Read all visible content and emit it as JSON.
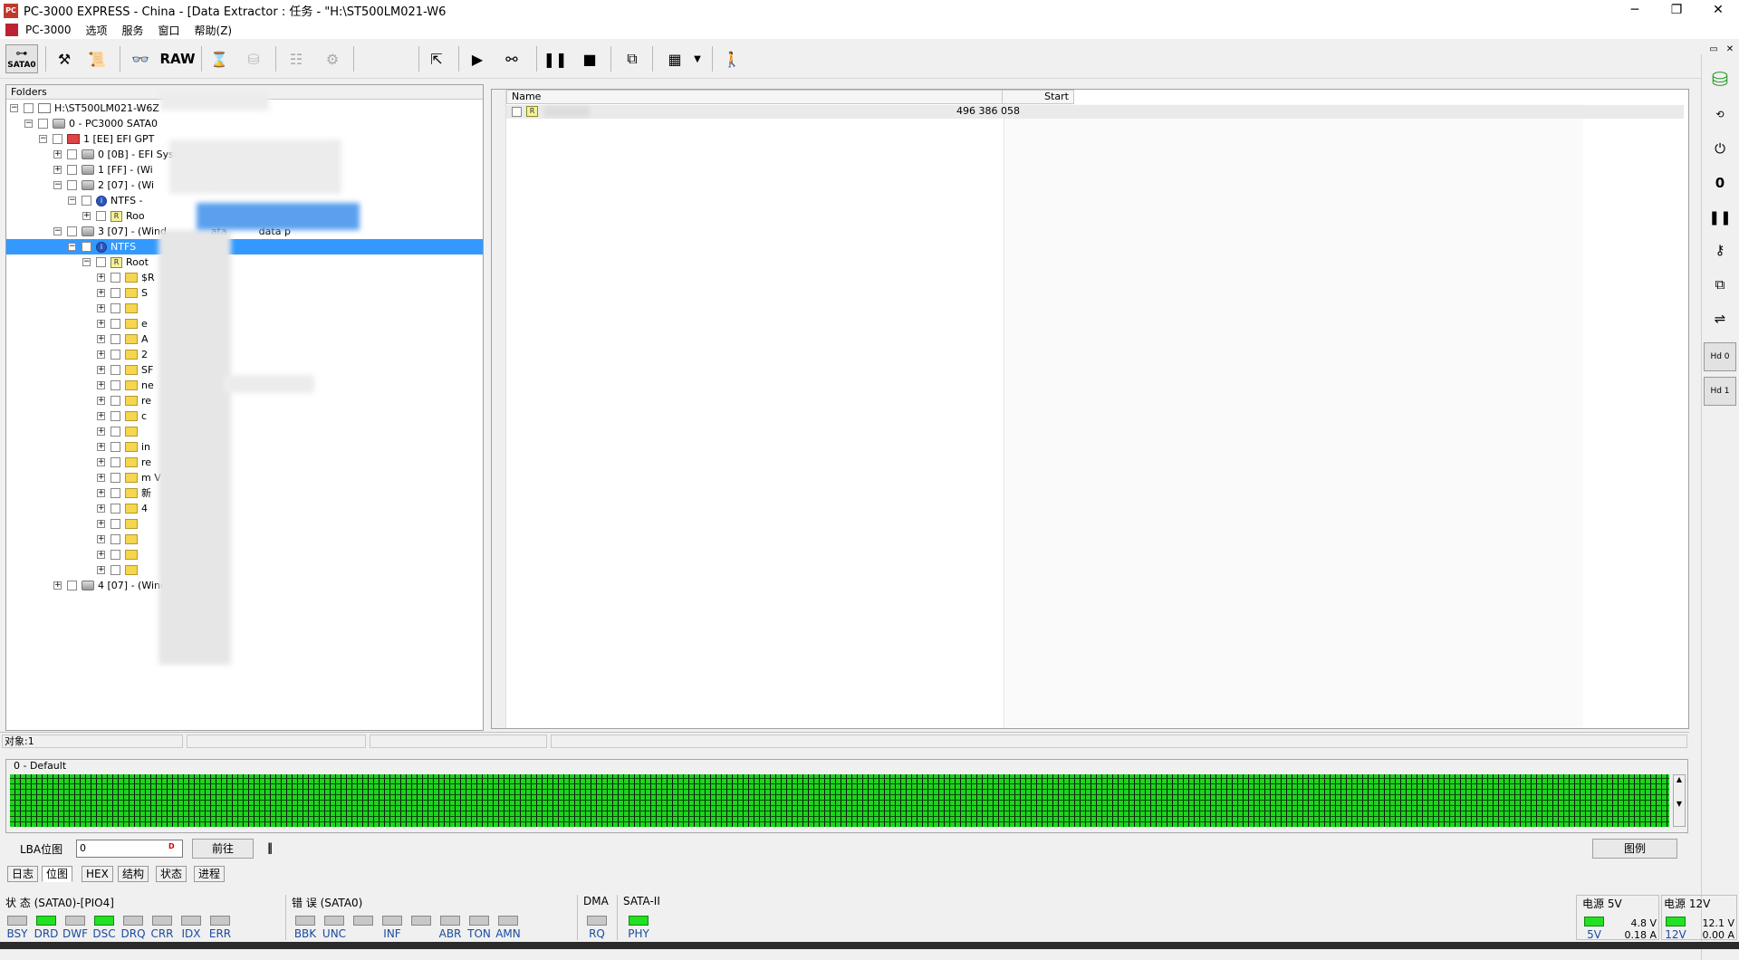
{
  "window": {
    "title": "PC-3000 EXPRESS - China - [Data Extractor : 任务 - \"H:\\ST500LM021-W6",
    "controls": {
      "minimize": "─",
      "restore": "❐",
      "close": "✕"
    }
  },
  "menu": {
    "items": [
      "PC-3000",
      "选项",
      "服务",
      "窗口",
      "帮助(Z)"
    ],
    "mdi_controls": {
      "minimize": "_",
      "restore": "▭",
      "close": "✕"
    }
  },
  "toolbar": {
    "sata_label": "SATA0",
    "raw_label": "RAW"
  },
  "folders": {
    "header": "Folders",
    "rows": [
      {
        "label": "H:\\ST500LM021-W6Z",
        "expander": "−",
        "icon": "computer"
      },
      {
        "label": "0 - PC3000 SATA0",
        "expander": "−",
        "icon": "drive"
      },
      {
        "label": "1 [EE] EFI GPT",
        "expander": "−",
        "icon": "efi"
      },
      {
        "label": "0 [0B] - EFI System - EFI",
        "expander": "+",
        "icon": "drive"
      },
      {
        "label": "1 [FF] - (Wi        ) Rese          s            rtition",
        "expander": "+",
        "icon": "drive"
      },
      {
        "label": "2 [07] - (Wi        /Linux)        asic         ar",
        "expander": "−",
        "icon": "drive"
      },
      {
        "label": "NTFS -",
        "expander": "−",
        "icon": "ntfs"
      },
      {
        "label": "Roo",
        "expander": "+",
        "icon": "root"
      },
      {
        "label": "3 [07] - (Wind              ata          data p",
        "expander": "−",
        "icon": "drive"
      },
      {
        "label": "NTFS",
        "expander": "−",
        "icon": "ntfs",
        "selected": true
      },
      {
        "label": "Root",
        "expander": "−",
        "icon": "root"
      },
      {
        "label": "$R",
        "expander": "+",
        "icon": "folder"
      },
      {
        "label": "S",
        "expander": "+",
        "icon": "folder"
      },
      {
        "label": "",
        "expander": "+",
        "icon": "folder"
      },
      {
        "label": "e",
        "expander": "+",
        "icon": "folder"
      },
      {
        "label": "A",
        "expander": "+",
        "icon": "folder"
      },
      {
        "label": "2",
        "expander": "+",
        "icon": "folder"
      },
      {
        "label": "SF       7.0",
        "expander": "+",
        "icon": "folder"
      },
      {
        "label": "ne",
        "expander": "+",
        "icon": "folder"
      },
      {
        "label": "re",
        "expander": "+",
        "icon": "folder"
      },
      {
        "label": "c",
        "expander": "+",
        "icon": "folder"
      },
      {
        "label": "",
        "expander": "+",
        "icon": "folder"
      },
      {
        "label": "in",
        "expander": "+",
        "icon": "folder"
      },
      {
        "label": "re",
        "expander": "+",
        "icon": "folder"
      },
      {
        "label": "m V           ation",
        "expander": "+",
        "icon": "folder"
      },
      {
        "label": "新",
        "expander": "+",
        "icon": "folder"
      },
      {
        "label": "4",
        "expander": "+",
        "icon": "folder"
      },
      {
        "label": "",
        "expander": "+",
        "icon": "folder"
      },
      {
        "label": "",
        "expander": "+",
        "icon": "folder"
      },
      {
        "label": "",
        "expander": "+",
        "icon": "folder"
      },
      {
        "label": "",
        "expander": "+",
        "icon": "folder"
      },
      {
        "label": "4 [07] - (Wind",
        "expander": "+",
        "icon": "drive"
      }
    ]
  },
  "list": {
    "headers": {
      "name": "Name",
      "start": "Start"
    },
    "rows": [
      {
        "icon": "root",
        "name": "",
        "start": "496 386 058"
      }
    ]
  },
  "status_bar": {
    "objects": "对象:1"
  },
  "bitmap": {
    "group_label": "0 - Default",
    "fill_fraction": 1.0,
    "color": "#1dd41d"
  },
  "lba": {
    "label": "LBA位图",
    "value": "0",
    "go_button": "前往",
    "pause_button": "‖",
    "legend_button": "图例"
  },
  "tabs": [
    "日志",
    "位图",
    "HEX",
    "结构",
    "状态",
    "进程"
  ],
  "indicators": {
    "status_group": {
      "label": "状 态 (SATA0)-[PIO4]",
      "leds": [
        {
          "name": "BSY",
          "on": false
        },
        {
          "name": "DRD",
          "on": true
        },
        {
          "name": "DWF",
          "on": false
        },
        {
          "name": "DSC",
          "on": true
        },
        {
          "name": "DRQ",
          "on": false
        },
        {
          "name": "CRR",
          "on": false
        },
        {
          "name": "IDX",
          "on": false
        },
        {
          "name": "ERR",
          "on": false
        }
      ]
    },
    "error_group": {
      "label": "错 误 (SATA0)",
      "leds": [
        {
          "name": "BBK",
          "on": false
        },
        {
          "name": "UNC",
          "on": false
        },
        {
          "name": "",
          "on": false
        },
        {
          "name": "INF",
          "on": false
        },
        {
          "name": "",
          "on": false
        },
        {
          "name": "ABR",
          "on": false
        },
        {
          "name": "TON",
          "on": false
        },
        {
          "name": "AMN",
          "on": false
        }
      ]
    },
    "dma_group": {
      "label": "DMA",
      "leds": [
        {
          "name": "RQ",
          "on": false
        }
      ]
    },
    "sata_group": {
      "label": "SATA-II",
      "leds": [
        {
          "name": "PHY",
          "on": true
        }
      ]
    },
    "power5": {
      "label": "电源 5V",
      "led": "5V",
      "voltage": "4.8 V",
      "current": "0.18 A"
    },
    "power12": {
      "label": "电源 12V",
      "led": "12V",
      "voltage": "12.1 V",
      "current": "0.00 A"
    }
  }
}
